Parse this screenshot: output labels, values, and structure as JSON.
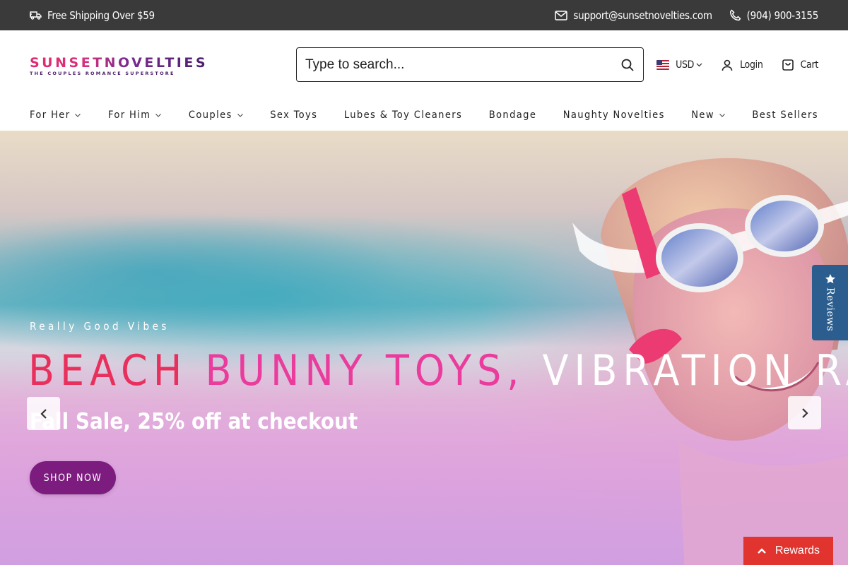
{
  "topbar": {
    "shipping_text": "Free Shipping Over $59",
    "shipping_icon": "truck-icon",
    "email": "support@sunsetnovelties.com",
    "email_icon": "mail-icon",
    "phone": "(904) 900-3155",
    "phone_icon": "phone-icon",
    "background": "#3a3a3a"
  },
  "logo": {
    "word": "SUNSETNOVELTIES",
    "tagline": "THE COUPLES ROMANCE SUPERSTORE",
    "colors": [
      "#e02a6e",
      "#7a2b8f",
      "#4b1f6d"
    ]
  },
  "search": {
    "placeholder": "Type to search...",
    "value": ""
  },
  "header_actions": {
    "currency": "USD",
    "currency_flag": "us-flag-icon",
    "login_label": "Login",
    "cart_label": "Cart"
  },
  "nav": {
    "items": [
      {
        "label": "For Her",
        "has_dropdown": true
      },
      {
        "label": "For Him",
        "has_dropdown": true
      },
      {
        "label": "Couples",
        "has_dropdown": true
      },
      {
        "label": "Sex Toys",
        "has_dropdown": false
      },
      {
        "label": "Lubes & Toy Cleaners",
        "has_dropdown": false
      },
      {
        "label": "Bondage",
        "has_dropdown": false
      },
      {
        "label": "Naughty Novelties",
        "has_dropdown": false
      },
      {
        "label": "New",
        "has_dropdown": true
      },
      {
        "label": "Best Sellers",
        "has_dropdown": false
      }
    ]
  },
  "hero": {
    "kicker": "Really Good Vibes",
    "headline_part1": "BEACH ",
    "headline_part2": "BUNNY TOYS, ",
    "headline_part3": "VIBRATION RABBITS",
    "subhead": "Fall Sale, 25% off at checkout",
    "cta_label": "SHOP NOW",
    "cta_color": "#7b1c7e",
    "headline_colors": [
      "#e8305c",
      "#e93c9c",
      "#ffffff"
    ]
  },
  "widgets": {
    "reviews_label": "Reviews",
    "reviews_color": "#2b5e8e",
    "rewards_label": "Rewards",
    "rewards_color": "#e1342f"
  }
}
